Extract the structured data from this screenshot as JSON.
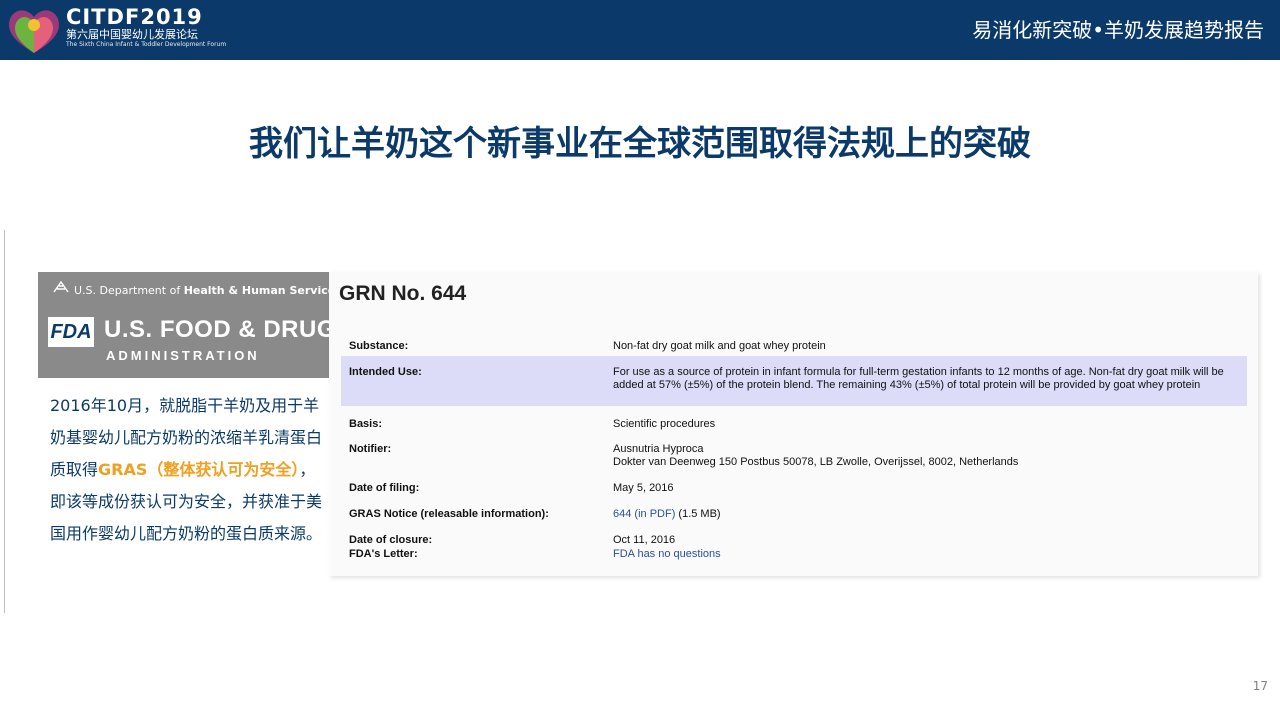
{
  "header": {
    "brand_name": "CITDF2019",
    "brand_cn": "第六届中国婴幼儿发展论坛",
    "brand_en": "The Sixth China Infant & Toddler Development Forum",
    "report_title": "易消化新突破•羊奶发展趋势报告",
    "bar_color": "#0b3a6a"
  },
  "slide": {
    "title": "我们让羊奶这个新事业在全球范围取得法规上的突破",
    "page_number": "17"
  },
  "fda_panel": {
    "hhs_prefix": "U.S. Department of ",
    "hhs_bold": "Health & Human Services",
    "badge": "FDA",
    "name": "U.S. FOOD & DRUG",
    "admin": "ADMINISTRATION"
  },
  "description": {
    "part1": "2016年10月，就脱脂干羊奶及用于羊奶基婴幼儿配方奶粉的浓缩羊乳清蛋白质取得",
    "highlight": "GRAS（整体获认可为安全）",
    "part2": "，即该等成份获认可为安全，并获准于美国用作婴幼儿配方奶粉的蛋白质来源。",
    "highlight_color": "#f0a020"
  },
  "grn": {
    "heading": "GRN No. 644",
    "rows": [
      {
        "label": "Substance:",
        "value": "Non-fat dry goat milk and goat whey protein"
      },
      {
        "label": "Intended Use:",
        "value": "For use as a source of protein in infant formula for full-term gestation infants to 12 months of age. Non-fat dry goat milk will be added at 57% (±5%) of the protein blend. The remaining 43% (±5%) of total protein will be provided by goat whey protein"
      },
      {
        "label": "Basis:",
        "value": "Scientific procedures"
      },
      {
        "label": "Notifier:",
        "value": "Ausnutria Hyproca",
        "value2": "Dokter van Deenweg 150 Postbus 50078, LB Zwolle, Overijssel, 8002, Netherlands"
      },
      {
        "label": "Date of filing:",
        "value": "May 5, 2016"
      },
      {
        "label": "GRAS Notice (releasable information):",
        "link": "644 (in PDF)",
        "value": " (1.5 MB)"
      },
      {
        "label": "Date of closure:",
        "value": "Oct 11, 2016"
      },
      {
        "label": "FDA's Letter:",
        "link": "FDA has no questions"
      }
    ]
  }
}
